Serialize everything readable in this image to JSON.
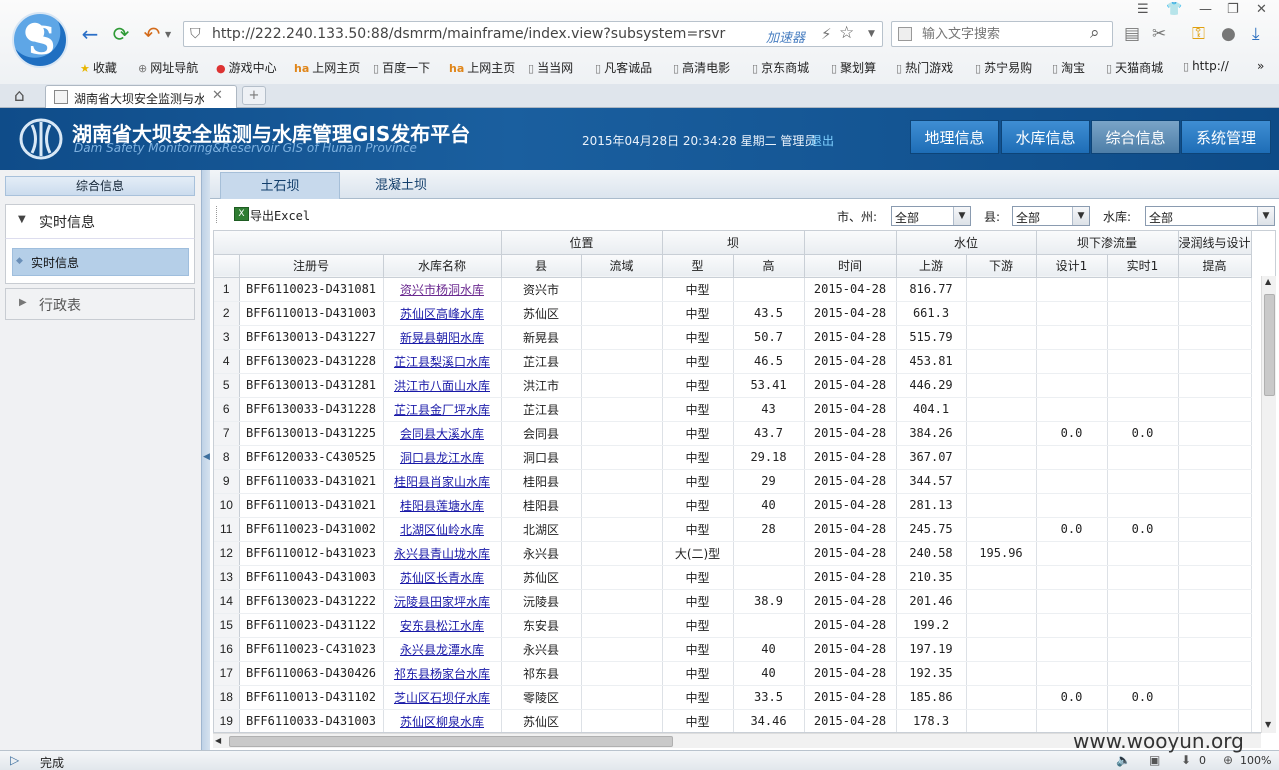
{
  "browser": {
    "address": "http://222.240.133.50:88/dsmrm/mainframe/index.view?subsystem=rsvr",
    "accelerator_label": "加速器",
    "search_placeholder": "输入文字搜索",
    "tab_title": "湖南省大坝安全监测与水",
    "new_tab": "+",
    "bookmarks": [
      "收藏",
      "网址导航",
      "游戏中心",
      "上网主页",
      "百度一下",
      "上网主页",
      "当当网",
      "凡客诚品",
      "高清电影",
      "京东商城",
      "聚划算",
      "热门游戏",
      "苏宁易购",
      "淘宝",
      "天猫商城",
      "http://"
    ],
    "bookmark_more": "»",
    "status": "完成",
    "download_count": "0",
    "zoom": "100%",
    "watermark": "www.wooyun.org"
  },
  "app": {
    "title": "湖南省大坝安全监测与水库管理GIS发布平台",
    "subtitle": "Dam Safety Monitoring&Reservoir GIS of Hunan Province",
    "datetime": "2015年04月28日 20:34:28 星期二 管理员",
    "logout": "退出",
    "nav": [
      "地理信息",
      "水库信息",
      "综合信息",
      "系统管理"
    ],
    "nav_active": "综合信息"
  },
  "sidebar": {
    "title": "综合信息",
    "sections": [
      {
        "label": "实时信息",
        "expanded": true,
        "items": [
          "实时信息"
        ]
      },
      {
        "label": "行政表",
        "expanded": false
      }
    ]
  },
  "main": {
    "tabs": [
      "土石坝",
      "混凝土坝"
    ],
    "active_tab": "土石坝",
    "export_label": "导出Excel",
    "filters": {
      "city_label": "市、州:",
      "city_value": "全部",
      "county_label": "县:",
      "county_value": "全部",
      "reservoir_label": "水库:",
      "reservoir_value": "全部"
    }
  },
  "table": {
    "group_headers": [
      "位置",
      "坝",
      "水位",
      "坝下渗流量",
      "浸润线与设计"
    ],
    "columns": [
      "注册号",
      "水库名称",
      "县",
      "流域",
      "型",
      "高",
      "时间",
      "上游",
      "下游",
      "设计1",
      "实时1",
      "提高"
    ],
    "rows": [
      [
        "1",
        "BFF6110023-D431081",
        "资兴市杨洞水库",
        "资兴市",
        "",
        "中型",
        "",
        "2015-04-28",
        "816.77",
        "",
        "",
        "",
        ""
      ],
      [
        "2",
        "BFF6110013-D431003",
        "苏仙区高峰水库",
        "苏仙区",
        "",
        "中型",
        "43.5",
        "2015-04-28",
        "661.3",
        "",
        "",
        "",
        ""
      ],
      [
        "3",
        "BFF6130013-D431227",
        "新晃县朝阳水库",
        "新晃县",
        "",
        "中型",
        "50.7",
        "2015-04-28",
        "515.79",
        "",
        "",
        "",
        ""
      ],
      [
        "4",
        "BFF6130023-D431228",
        "芷江县梨溪口水库",
        "芷江县",
        "",
        "中型",
        "46.5",
        "2015-04-28",
        "453.81",
        "",
        "",
        "",
        ""
      ],
      [
        "5",
        "BFF6130013-D431281",
        "洪江市八面山水库",
        "洪江市",
        "",
        "中型",
        "53.41",
        "2015-04-28",
        "446.29",
        "",
        "",
        "",
        ""
      ],
      [
        "6",
        "BFF6130033-D431228",
        "芷江县金厂坪水库",
        "芷江县",
        "",
        "中型",
        "43",
        "2015-04-28",
        "404.1",
        "",
        "",
        "",
        ""
      ],
      [
        "7",
        "BFF6130013-D431225",
        "会同县大溪水库",
        "会同县",
        "",
        "中型",
        "43.7",
        "2015-04-28",
        "384.26",
        "",
        "0.0",
        "0.0",
        ""
      ],
      [
        "8",
        "BFF6120033-C430525",
        "洞口县龙江水库",
        "洞口县",
        "",
        "中型",
        "29.18",
        "2015-04-28",
        "367.07",
        "",
        "",
        "",
        ""
      ],
      [
        "9",
        "BFF6110033-D431021",
        "桂阳县肖家山水库",
        "桂阳县",
        "",
        "中型",
        "29",
        "2015-04-28",
        "344.57",
        "",
        "",
        "",
        ""
      ],
      [
        "10",
        "BFF6110013-D431021",
        "桂阳县莲塘水库",
        "桂阳县",
        "",
        "中型",
        "40",
        "2015-04-28",
        "281.13",
        "",
        "",
        "",
        ""
      ],
      [
        "11",
        "BFF6110023-D431002",
        "北湖区仙岭水库",
        "北湖区",
        "",
        "中型",
        "28",
        "2015-04-28",
        "245.75",
        "",
        "0.0",
        "0.0",
        ""
      ],
      [
        "12",
        "BFF6110012-b431023",
        "永兴县青山垅水库",
        "永兴县",
        "",
        "大(二)型",
        "",
        "2015-04-28",
        "240.58",
        "195.96",
        "",
        "",
        ""
      ],
      [
        "13",
        "BFF6110043-D431003",
        "苏仙区长青水库",
        "苏仙区",
        "",
        "中型",
        "",
        "2015-04-28",
        "210.35",
        "",
        "",
        "",
        ""
      ],
      [
        "14",
        "BFF6130023-D431222",
        "沅陵县田家坪水库",
        "沅陵县",
        "",
        "中型",
        "38.9",
        "2015-04-28",
        "201.46",
        "",
        "",
        "",
        ""
      ],
      [
        "15",
        "BFF6110023-D431122",
        "安东县松江水库",
        "东安县",
        "",
        "中型",
        "",
        "2015-04-28",
        "199.2",
        "",
        "",
        "",
        ""
      ],
      [
        "16",
        "BFF6110023-C431023",
        "永兴县龙潭水库",
        "永兴县",
        "",
        "中型",
        "40",
        "2015-04-28",
        "197.19",
        "",
        "",
        "",
        ""
      ],
      [
        "17",
        "BFF6110063-D430426",
        "祁东县杨家台水库",
        "祁东县",
        "",
        "中型",
        "40",
        "2015-04-28",
        "192.35",
        "",
        "",
        "",
        ""
      ],
      [
        "18",
        "BFF6110013-D431102",
        "芝山区石坝仔水库",
        "零陵区",
        "",
        "中型",
        "33.5",
        "2015-04-28",
        "185.86",
        "",
        "0.0",
        "0.0",
        ""
      ],
      [
        "19",
        "BFF6110033-D431003",
        "苏仙区柳泉水库",
        "苏仙区",
        "",
        "中型",
        "34.46",
        "2015-04-28",
        "178.3",
        "",
        "",
        "",
        ""
      ]
    ]
  }
}
